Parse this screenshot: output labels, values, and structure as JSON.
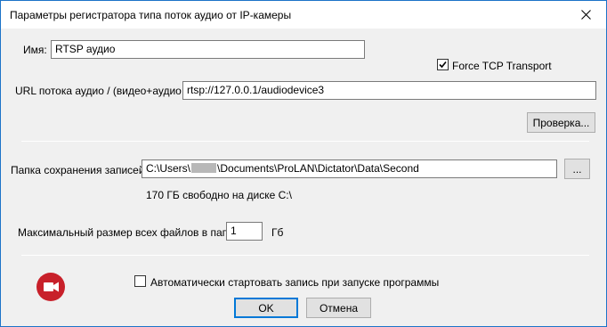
{
  "window": {
    "title": "Параметры регистратора типа поток аудио от IP-камеры"
  },
  "name_field": {
    "label": "Имя:",
    "value": "RTSP аудио"
  },
  "force_tcp": {
    "label": "Force TCP Transport",
    "checked": true
  },
  "url_field": {
    "label": "URL потока аудио / (видео+аудио:",
    "value": "rtsp://127.0.0.1/audiodevice3"
  },
  "check_button": {
    "label": "Проверка..."
  },
  "folder_field": {
    "label": "Папка сохранения записей:",
    "value_prefix": "C:\\Users\\",
    "value_suffix": "\\Documents\\ProLAN\\Dictator\\Data\\Second",
    "browse_label": "..."
  },
  "free_space": {
    "text": "170 ГБ свободно на диске C:\\"
  },
  "max_size": {
    "label": "Максимальный размер всех файлов в папке:",
    "value": "1",
    "unit": "Гб"
  },
  "autostart": {
    "label": "Автоматически стартовать запись при запуске программы",
    "checked": false
  },
  "buttons": {
    "ok": "OK",
    "cancel": "Отмена"
  },
  "colors": {
    "accent": "#0078d7",
    "record_icon": "#c8202a"
  },
  "icons": {
    "close": "close-icon",
    "record": "video-camera-icon"
  }
}
